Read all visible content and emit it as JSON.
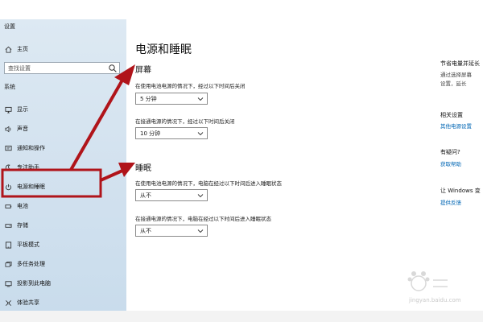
{
  "window": {
    "title": "设置"
  },
  "sidebar": {
    "search_placeholder": "查找设置",
    "section_header": "系统",
    "items": [
      {
        "label": "主页",
        "icon": "home-icon"
      },
      {
        "label": "显示",
        "icon": "display-icon"
      },
      {
        "label": "声音",
        "icon": "speaker-icon"
      },
      {
        "label": "通知和操作",
        "icon": "notification-icon"
      },
      {
        "label": "专注助手",
        "icon": "moon-icon"
      },
      {
        "label": "电源和睡眠",
        "icon": "power-icon"
      },
      {
        "label": "电池",
        "icon": "battery-icon"
      },
      {
        "label": "存储",
        "icon": "storage-icon"
      },
      {
        "label": "平板模式",
        "icon": "tablet-icon"
      },
      {
        "label": "多任务处理",
        "icon": "multitask-icon"
      },
      {
        "label": "投影到此电脑",
        "icon": "project-icon"
      },
      {
        "label": "体验共享",
        "icon": "share-icon"
      }
    ]
  },
  "main": {
    "title": "电源和睡眠",
    "screen": {
      "header": "屏幕",
      "battery_label": "在使用电池电源的情况下，经过以下时间后关闭",
      "battery_value": "5 分钟",
      "plugged_label": "在接通电源的情况下，经过以下时间后关闭",
      "plugged_value": "10 分钟"
    },
    "sleep": {
      "header": "睡眠",
      "battery_label": "在使用电池电源的情况下，电脑在经过以下时间后进入睡眠状态",
      "battery_value": "从不",
      "plugged_label": "在接通电源的情况下，电脑在经过以下时间后进入睡眠状态",
      "plugged_value": "从不"
    }
  },
  "right_panel": {
    "energy_header": "节省电量并延长",
    "energy_text_1": "通过选择屏幕",
    "energy_text_2": "设置，延长",
    "related_header": "相关设置",
    "related_link": "其他电源设置",
    "question_header": "有疑问?",
    "help_link": "获取帮助",
    "improve_header": "让 Windows 变",
    "feedback_link": "提供反馈"
  },
  "watermark": {
    "text": "jingyan.baidu.com"
  },
  "colors": {
    "sidebar_bg": "#d3e2ef",
    "link": "#0066b4",
    "annotation": "#b0141a"
  }
}
